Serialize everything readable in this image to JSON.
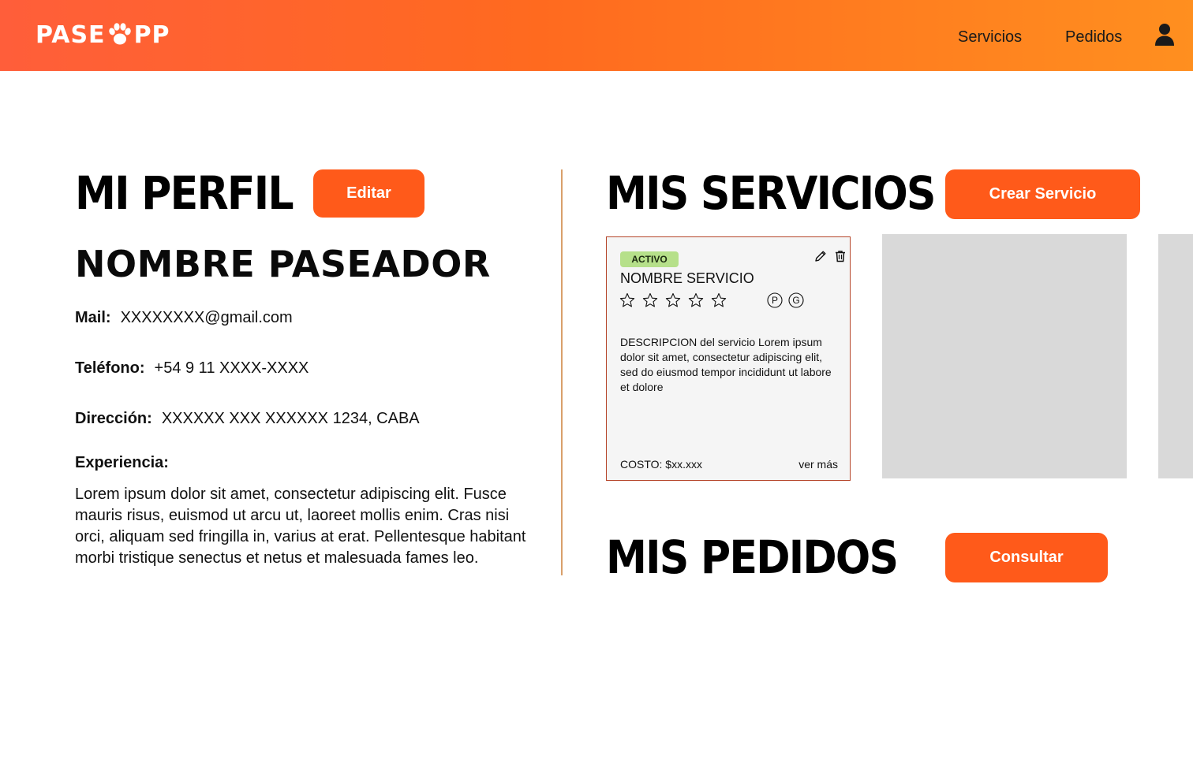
{
  "header": {
    "logo_left": "PASE",
    "logo_right": "PP",
    "nav": [
      "Servicios",
      "Pedidos"
    ],
    "user_icon": "user-icon",
    "gradient_start": "#ff5e3a",
    "gradient_end": "#ff8f1f"
  },
  "profile": {
    "title": "MI PERFIL",
    "edit_label": "Editar",
    "name": "NOMBRE PASEADOR",
    "mail_label": "Mail:",
    "mail_value": "XXXXXXXX@gmail.com",
    "phone_label": "Teléfono:",
    "phone_value": "+54 9 11 XXXX-XXXX",
    "address_label": "Dirección:",
    "address_value": "XXXXXX XXX XXXXXX 1234, CABA",
    "experience_label": "Experiencia:",
    "experience_text": "Lorem ipsum dolor sit amet, consectetur adipiscing elit. Fusce mauris risus, euismod ut arcu ut, laoreet mollis enim. Cras nisi orci, aliquam sed fringilla in, varius at erat. Pellentesque habitant morbi tristique senectus et netus et malesuada fames leo."
  },
  "services": {
    "title": "MIS SERVICIOS",
    "create_label": "Crear Servicio",
    "card": {
      "status": "ACTIVO",
      "name": "NOMBRE SERVICIO",
      "rating_stars": 5,
      "badge_p": "P",
      "badge_g": "G",
      "description": "DESCRIPCION del servicio Lorem ipsum dolor sit amet, consectetur adipiscing elit, sed do eiusmod tempor incididunt ut labore et dolore",
      "cost": "COSTO: $xx.xxx",
      "more": "ver más"
    }
  },
  "orders": {
    "title": "MIS PEDIDOS",
    "consult_label": "Consultar"
  },
  "colors": {
    "accent": "#ff5a1a",
    "status_active": "#b6e08a",
    "divider": "#d9a06b",
    "card_border": "#b5452a",
    "placeholder": "#d9d9d9"
  }
}
